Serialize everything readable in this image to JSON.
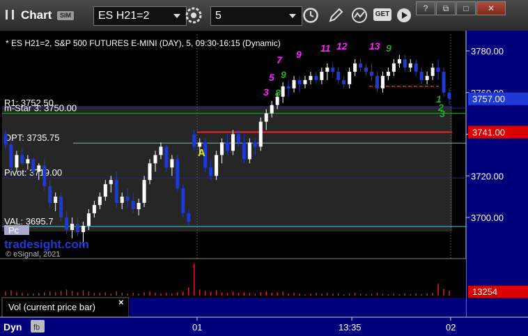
{
  "window": {
    "title": "Chart",
    "sim_badge": "SIM",
    "symbol": "ES H21=2",
    "interval": "5",
    "get_label": "GET"
  },
  "header_text": "* ES H21=2, S&P 500 FUTURES E-MINI (DAY), 5, 09:30-16:15 (Dynamic)",
  "watermark": {
    "brand": "tradesight.com",
    "copyright": "© eSignal, 2021"
  },
  "levels": [
    {
      "label": "R1: 3752.50",
      "value": 3752.5,
      "color": "#1e1ecc"
    },
    {
      "label": "m-Star 3: 3750.00",
      "value": 3750.0,
      "color": "#2ea02e"
    },
    {
      "label": "OPT: 3735.75",
      "value": 3735.75,
      "color": "#4cc8c8"
    },
    {
      "label": "Pivot: 3719.00",
      "value": 3719.0,
      "color": "#1e1ecc"
    },
    {
      "label": "VAL: 3695.7",
      "value": 3695.7,
      "color": "#4cc8c8"
    }
  ],
  "pc_label": "Pc",
  "marker_a": "A",
  "price_axis": {
    "ticks": [
      "3780.00",
      "3760.00",
      "3740.00",
      "3720.00",
      "3700.00"
    ],
    "tick_values": [
      3780,
      3760,
      3740,
      3720,
      3700
    ],
    "current_price": "3757.00",
    "current_value": 3757.0,
    "red_level": "3741.00",
    "red_value": 3741.0
  },
  "volume": {
    "panel_label": "Vol (current price bar)",
    "current": "13254",
    "close_label": "×"
  },
  "time_axis": {
    "labels": [
      "01",
      "13:35",
      "02"
    ]
  },
  "status": {
    "label": "Dyn"
  },
  "td_counts": [
    {
      "text": "7",
      "color": "#ff22ff"
    },
    {
      "text": "9",
      "color": "#ff22ff"
    },
    {
      "text": "11",
      "color": "#ff22ff"
    },
    {
      "text": "12",
      "color": "#ff22ff"
    },
    {
      "text": "13",
      "color": "#ff22ff"
    },
    {
      "text": "5",
      "color": "#ff22ff"
    },
    {
      "text": "3",
      "color": "#ff22ff"
    },
    {
      "text": "9",
      "color": "#22aa22"
    },
    {
      "text": "8",
      "color": "#22aa22"
    },
    {
      "text": "1",
      "color": "#22aa22"
    },
    {
      "text": "2",
      "color": "#22aa22"
    },
    {
      "text": "3",
      "color": "#22aa22"
    },
    {
      "text": "9",
      "color": "#22aa22"
    }
  ],
  "chart_data": {
    "type": "candlestick",
    "y_range": [
      3680,
      3790
    ],
    "candles": [
      [
        3740,
        3742,
        3733,
        3735
      ],
      [
        3735,
        3737,
        3722,
        3724
      ],
      [
        3724,
        3732,
        3722,
        3730
      ],
      [
        3730,
        3733,
        3725,
        3726
      ],
      [
        3726,
        3730,
        3723,
        3728
      ],
      [
        3728,
        3729,
        3720,
        3722
      ],
      [
        3722,
        3726,
        3718,
        3725
      ],
      [
        3725,
        3728,
        3713,
        3715
      ],
      [
        3715,
        3718,
        3705,
        3707
      ],
      [
        3707,
        3712,
        3703,
        3710
      ],
      [
        3710,
        3712,
        3698,
        3700
      ],
      [
        3700,
        3703,
        3692,
        3694
      ],
      [
        3694,
        3700,
        3690,
        3697
      ],
      [
        3697,
        3700,
        3691,
        3693
      ],
      [
        3693,
        3698,
        3686,
        3696
      ],
      [
        3696,
        3704,
        3694,
        3702
      ],
      [
        3702,
        3708,
        3700,
        3706
      ],
      [
        3706,
        3712,
        3704,
        3710
      ],
      [
        3710,
        3718,
        3708,
        3716
      ],
      [
        3716,
        3720,
        3712,
        3718
      ],
      [
        3718,
        3722,
        3705,
        3707
      ],
      [
        3707,
        3712,
        3704,
        3710
      ],
      [
        3710,
        3714,
        3705,
        3708
      ],
      [
        3708,
        3712,
        3702,
        3704
      ],
      [
        3704,
        3709,
        3701,
        3707
      ],
      [
        3707,
        3720,
        3705,
        3718
      ],
      [
        3718,
        3728,
        3716,
        3726
      ],
      [
        3726,
        3732,
        3722,
        3730
      ],
      [
        3730,
        3736,
        3728,
        3734
      ],
      [
        3734,
        3735,
        3722,
        3724
      ],
      [
        3724,
        3730,
        3720,
        3728
      ],
      [
        3728,
        3730,
        3712,
        3714
      ],
      [
        3714,
        3716,
        3700,
        3702
      ],
      [
        3702,
        3704,
        3696,
        3698
      ],
      [
        3740,
        3742,
        3732,
        3734
      ],
      [
        3734,
        3738,
        3730,
        3736
      ],
      [
        3736,
        3738,
        3722,
        3724
      ],
      [
        3724,
        3728,
        3718,
        3720
      ],
      [
        3720,
        3732,
        3718,
        3730
      ],
      [
        3730,
        3738,
        3726,
        3736
      ],
      [
        3736,
        3740,
        3730,
        3732
      ],
      [
        3732,
        3742,
        3730,
        3740
      ],
      [
        3740,
        3742,
        3734,
        3736
      ],
      [
        3736,
        3740,
        3726,
        3728
      ],
      [
        3728,
        3738,
        3726,
        3736
      ],
      [
        3736,
        3738,
        3730,
        3734
      ],
      [
        3734,
        3748,
        3732,
        3746
      ],
      [
        3746,
        3752,
        3742,
        3750
      ],
      [
        3750,
        3756,
        3748,
        3754
      ],
      [
        3754,
        3760,
        3752,
        3758
      ],
      [
        3758,
        3765,
        3755,
        3763
      ],
      [
        3763,
        3766,
        3758,
        3762
      ],
      [
        3762,
        3768,
        3760,
        3766
      ],
      [
        3766,
        3768,
        3760,
        3764
      ],
      [
        3764,
        3768,
        3762,
        3766
      ],
      [
        3766,
        3770,
        3764,
        3768
      ],
      [
        3768,
        3770,
        3764,
        3766
      ],
      [
        3766,
        3772,
        3764,
        3770
      ],
      [
        3770,
        3774,
        3766,
        3772
      ],
      [
        3772,
        3774,
        3768,
        3770
      ],
      [
        3770,
        3772,
        3764,
        3766
      ],
      [
        3766,
        3768,
        3762,
        3764
      ],
      [
        3764,
        3772,
        3762,
        3770
      ],
      [
        3770,
        3776,
        3768,
        3774
      ],
      [
        3774,
        3776,
        3770,
        3772
      ],
      [
        3772,
        3774,
        3768,
        3770
      ],
      [
        3770,
        3774,
        3766,
        3768
      ],
      [
        3768,
        3770,
        3760,
        3762
      ],
      [
        3762,
        3770,
        3760,
        3768
      ],
      [
        3768,
        3772,
        3766,
        3770
      ],
      [
        3770,
        3776,
        3768,
        3774
      ],
      [
        3774,
        3778,
        3772,
        3776
      ],
      [
        3776,
        3778,
        3770,
        3772
      ],
      [
        3772,
        3776,
        3770,
        3774
      ],
      [
        3774,
        3776,
        3768,
        3770
      ],
      [
        3770,
        3772,
        3764,
        3766
      ],
      [
        3766,
        3770,
        3764,
        3768
      ],
      [
        3768,
        3774,
        3766,
        3772
      ],
      [
        3772,
        3776,
        3766,
        3770
      ],
      [
        3770,
        3772,
        3758,
        3760
      ],
      [
        3760,
        3762,
        3754,
        3757
      ]
    ],
    "volume": [
      6,
      8,
      5,
      4,
      3,
      3,
      4,
      5,
      6,
      5,
      7,
      9,
      7,
      5,
      8,
      6,
      4,
      4,
      5,
      3,
      6,
      4,
      3,
      4,
      3,
      5,
      6,
      4,
      3,
      4,
      3,
      5,
      6,
      12,
      48,
      9,
      7,
      6,
      8,
      5,
      4,
      6,
      4,
      5,
      4,
      3,
      5,
      6,
      4,
      5,
      6,
      3,
      4,
      3,
      2,
      3,
      4,
      3,
      4,
      3,
      3,
      2,
      3,
      4,
      3,
      2,
      3,
      4,
      3,
      2,
      3,
      2,
      3,
      2,
      3,
      2,
      3,
      4,
      18,
      10,
      7
    ]
  }
}
